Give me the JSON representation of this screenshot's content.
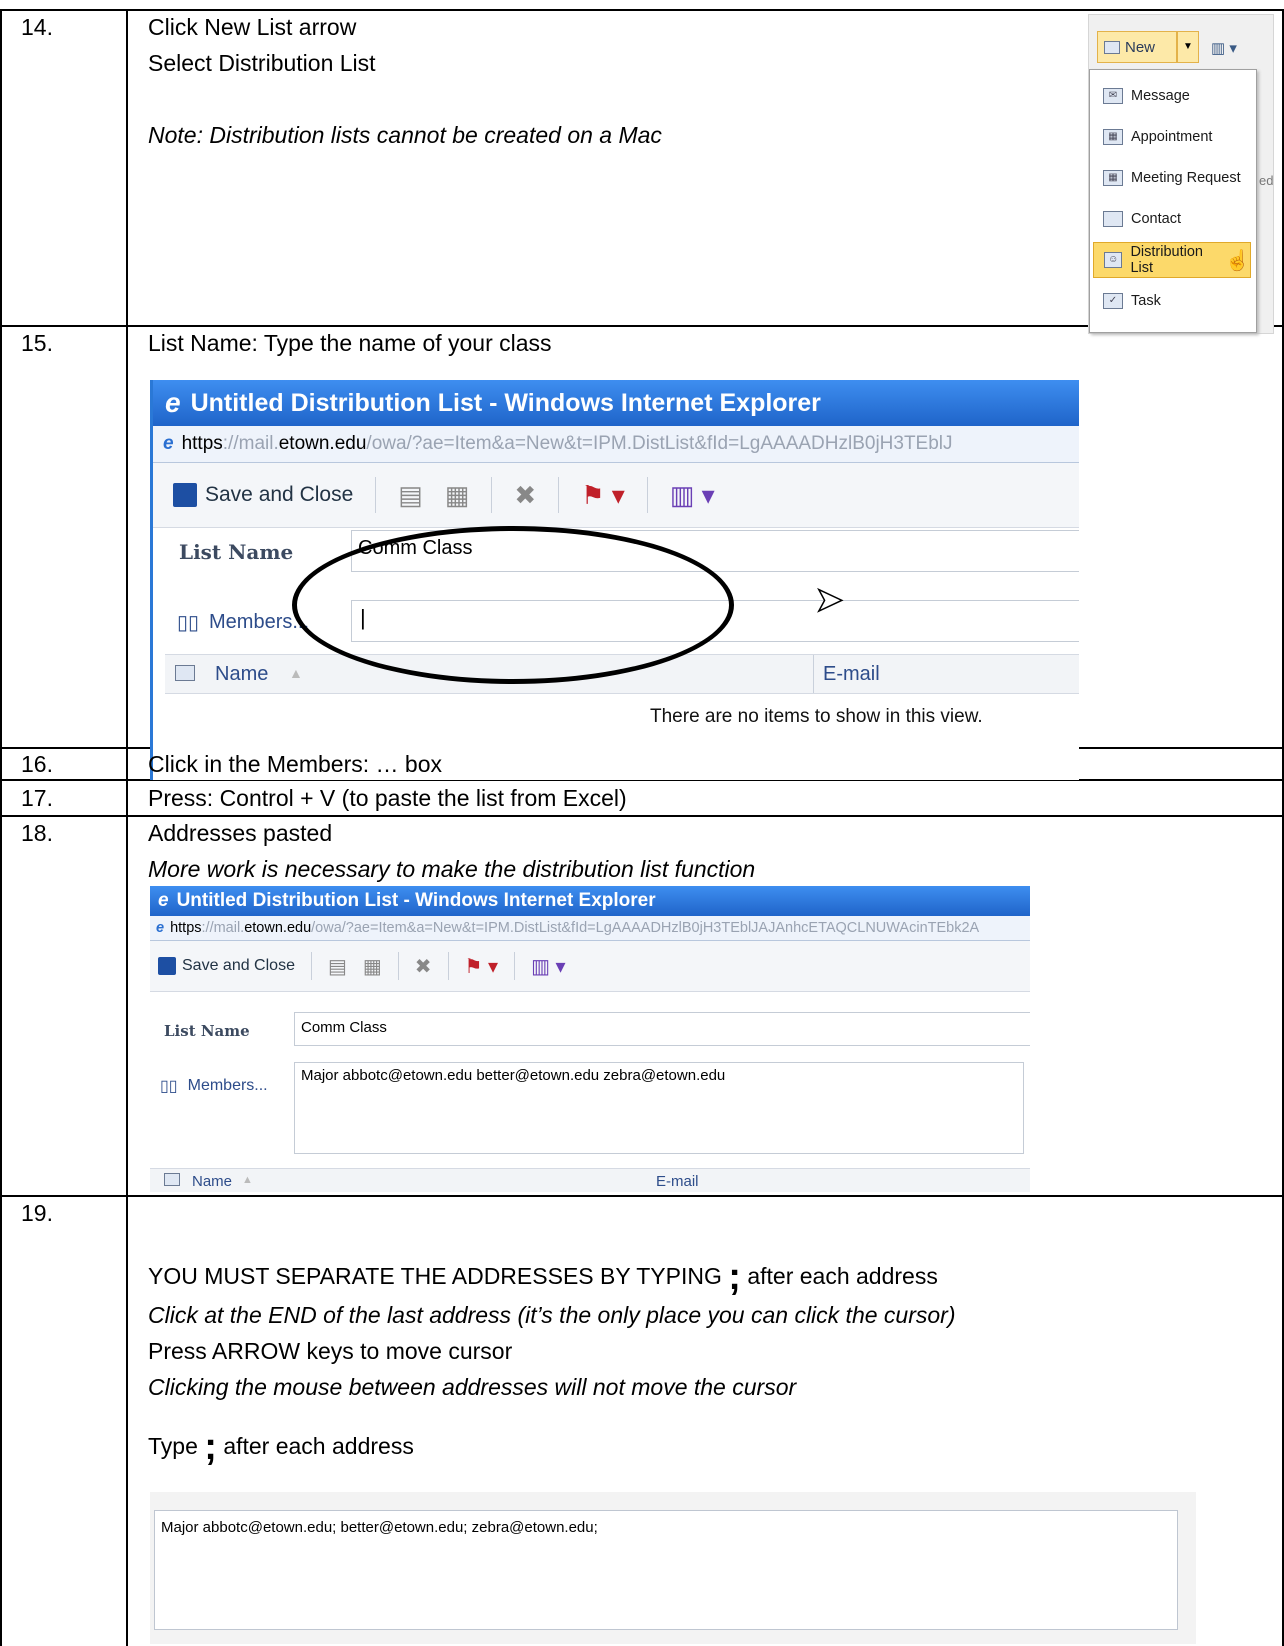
{
  "steps": {
    "s14": {
      "num": "14.",
      "line1": "Click New List arrow",
      "line2": "Select Distribution List",
      "note": "Note: Distribution lists cannot be created on a Mac"
    },
    "s15": {
      "num": "15.",
      "line1": "List Name: Type the name of your class"
    },
    "s16": {
      "num": "16.",
      "line1": "Click in the Members: … box"
    },
    "s17": {
      "num": "17.",
      "line1": "Press: Control + V (to paste the list from Excel)"
    },
    "s18": {
      "num": "18.",
      "line1": "Addresses pasted",
      "line2": "More work is necessary to make the distribution list function"
    },
    "s19": {
      "num": "19.",
      "line1_pre": "YOU MUST SEPARATE THE ADDRESSES BY TYPING",
      "semicolon": ";",
      "line1_post": "after each address",
      "line2": "Click at the END of the last address (it’s the only place you can click the cursor)",
      "line3": "Press ARROW keys to move cursor",
      "line4": "Clicking the mouse between addresses will not move the cursor",
      "line5_pre": "Type",
      "line5_post": "after each address",
      "final_text": "Major abbotc@etown.edu; better@etown.edu; zebra@etown.edu;"
    }
  },
  "menu": {
    "new_label": "New",
    "items": [
      "Message",
      "Appointment",
      "Meeting Request",
      "Contact",
      "Distribution List",
      "Task"
    ],
    "selected": "Distribution List",
    "partial_text": "ed"
  },
  "ie_window_1": {
    "title": "Untitled Distribution List - Windows Internet Explorer",
    "url_scheme": "https",
    "url_pre": "://mail.",
    "url_domain": "etown.edu",
    "url_path": "/owa/?ae=Item&a=New&t=IPM.DistList&fId=LgAAAADHzlB0jH3TEblJ",
    "save_close": "Save and Close",
    "list_name_label": "List Name",
    "list_name_value": "Comm Class",
    "members_label": "Members...",
    "members_value": "|",
    "col_name": "Name",
    "col_email": "E-mail",
    "empty_msg": "There are no items to show in this view."
  },
  "ie_window_2": {
    "title": "Untitled Distribution List - Windows Internet Explorer",
    "url_scheme": "https",
    "url_pre": "://mail.",
    "url_domain": "etown.edu",
    "url_path": "/owa/?ae=Item&a=New&t=IPM.DistList&fId=LgAAAADHzlB0jH3TEblJAJAnhcETAQCLNUWAcinTEbk2A",
    "save_close": "Save and Close",
    "list_name_label": "List Name",
    "list_name_value": "Comm Class",
    "members_label": "Members...",
    "members_value": "Major abbotc@etown.edu better@etown.edu zebra@etown.edu",
    "col_name": "Name",
    "col_email": "E-mail"
  },
  "colors": {
    "ie_title": "#1f64c9",
    "menu_highlight": "#fcd96a",
    "link_blue": "#2d4c8a"
  }
}
